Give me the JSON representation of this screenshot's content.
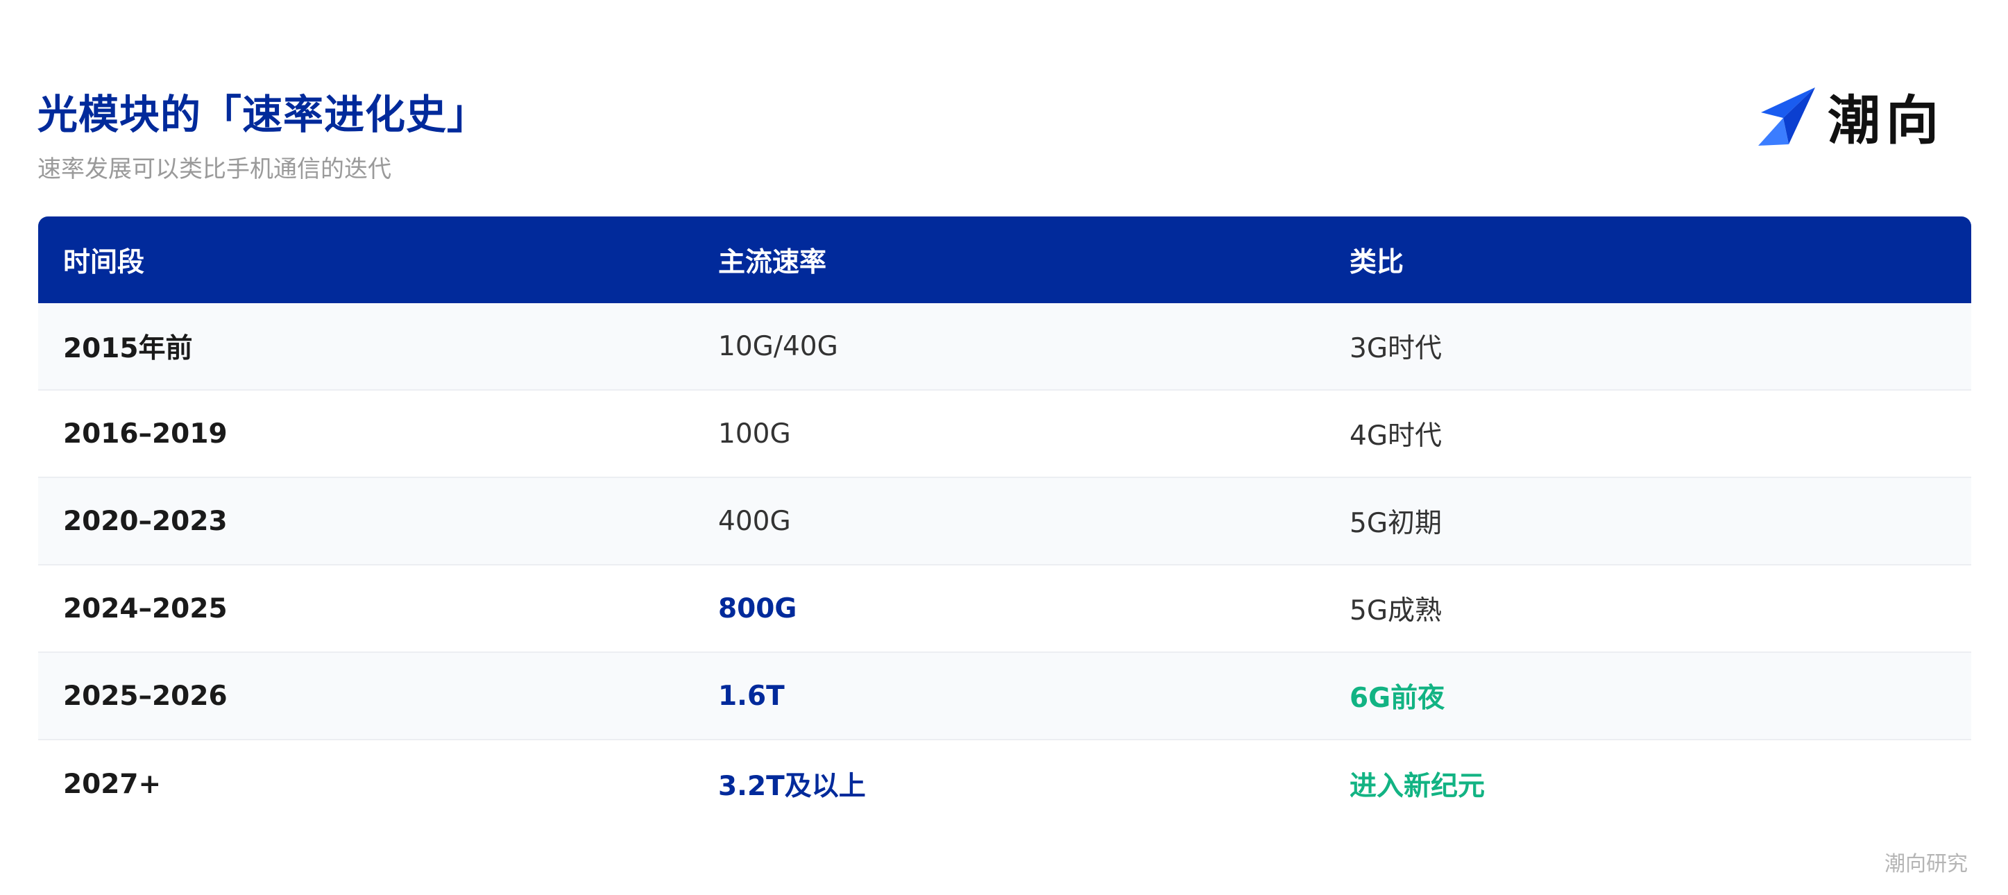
{
  "header": {
    "title": "光模块的「速率进化史」",
    "subtitle": "速率发展可以类比手机通信的迭代"
  },
  "logo": {
    "text": "潮向",
    "icon": "arrow-logo-icon",
    "color_primary": "#1a5cf0"
  },
  "colors": {
    "header_bg": "#012a9b",
    "accent_blue": "#012a9b",
    "accent_green": "#12b383"
  },
  "table": {
    "columns": [
      "时间段",
      "主流速率",
      "类比"
    ],
    "rows": [
      {
        "period": "2015年前",
        "rate": "10G/40G",
        "analogy": "3G时代"
      },
      {
        "period": "2016–2019",
        "rate": "100G",
        "analogy": "4G时代"
      },
      {
        "period": "2020–2023",
        "rate": "400G",
        "analogy": "5G初期"
      },
      {
        "period": "2024–2025",
        "rate": "800G",
        "analogy": "5G成熟"
      },
      {
        "period": "2025–2026",
        "rate": "1.6T",
        "analogy": "6G前夜"
      },
      {
        "period": "2027+",
        "rate": "3.2T及以上",
        "analogy": "进入新纪元"
      }
    ]
  },
  "footer": {
    "source": "潮向研究"
  }
}
